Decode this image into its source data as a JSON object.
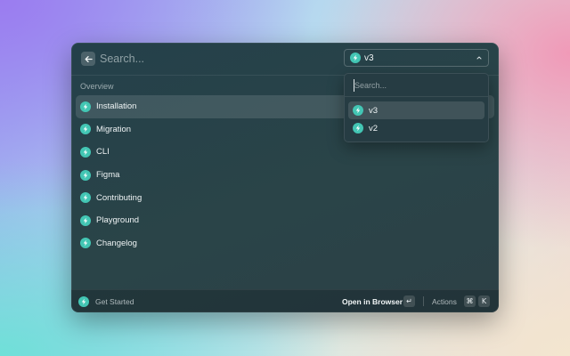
{
  "search": {
    "placeholder": "Search..."
  },
  "version_select": {
    "value": "v3"
  },
  "version_dropdown": {
    "search_placeholder": "Search...",
    "options": [
      "v3",
      "v2"
    ],
    "selected": "v3"
  },
  "section": {
    "title": "Overview"
  },
  "items": [
    {
      "label": "Installation",
      "selected": true
    },
    {
      "label": "Migration"
    },
    {
      "label": "CLI"
    },
    {
      "label": "Figma"
    },
    {
      "label": "Contributing"
    },
    {
      "label": "Playground"
    },
    {
      "label": "Changelog"
    }
  ],
  "footer": {
    "title": "Get Started",
    "primary_action": "Open in Browser",
    "primary_key": "↵",
    "actions_label": "Actions",
    "actions_keys": [
      "⌘",
      "K"
    ]
  },
  "icons": {
    "back": "arrow-left-icon",
    "item": "lightning-bolt-icon",
    "chevron": "chevron-up-down-icon"
  },
  "colors": {
    "accent": "#43c6b4"
  }
}
